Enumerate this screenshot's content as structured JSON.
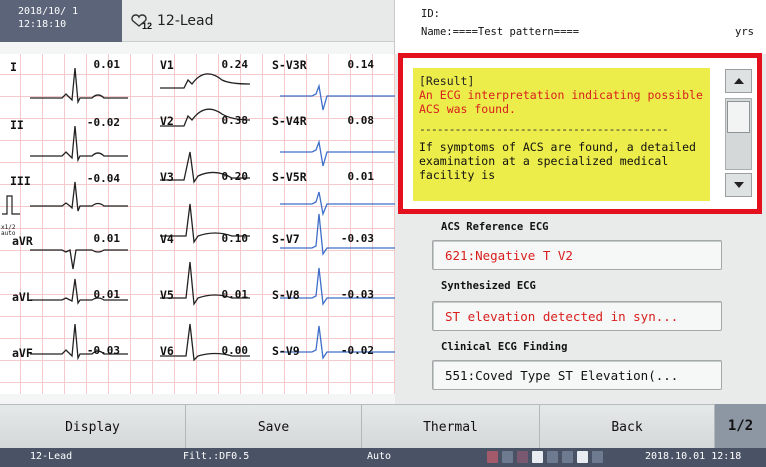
{
  "header": {
    "date": "2018/10/ 1",
    "time": "12:18:10",
    "title": "12-Lead",
    "heart_icon_subscript": "12"
  },
  "patient": {
    "id_label": "ID:",
    "name": "Name:====Test pattern====",
    "age_unit": "yrs"
  },
  "ecg": {
    "leads": [
      {
        "label": "I",
        "value": "0.01"
      },
      {
        "label": "II",
        "value": "-0.02"
      },
      {
        "label": "III",
        "value": "-0.04"
      },
      {
        "label": "aVR",
        "value": "0.01"
      },
      {
        "label": "aVL",
        "value": "0.01"
      },
      {
        "label": "aVF",
        "value": "-0.03"
      },
      {
        "label": "V1",
        "value": "0.24"
      },
      {
        "label": "V2",
        "value": "0.38"
      },
      {
        "label": "V3",
        "value": "0.20"
      },
      {
        "label": "V4",
        "value": "0.10"
      },
      {
        "label": "V5",
        "value": "0.01"
      },
      {
        "label": "V6",
        "value": "0.00"
      },
      {
        "label": "S-V3R",
        "value": "0.14"
      },
      {
        "label": "S-V4R",
        "value": "0.08"
      },
      {
        "label": "S-V5R",
        "value": "0.01"
      },
      {
        "label": "S-V7",
        "value": "-0.03"
      },
      {
        "label": "S-V8",
        "value": "-0.03"
      },
      {
        "label": "S-V9",
        "value": "-0.02"
      }
    ],
    "cal_label_1": "x1/2",
    "cal_label_2": "auto"
  },
  "result": {
    "header": "[Result]",
    "alert": "An ECG interpretation indicating possible ACS was found.",
    "separator": "------------------------------------------",
    "body": "If symptoms of ACS are found, a detailed examination at a specialized medical facility is"
  },
  "acs_reference": {
    "label": "ACS Reference ECG",
    "value": "621:Negative T V2"
  },
  "synthesized": {
    "label": "Synthesized ECG",
    "value": "ST elevation detected in syn..."
  },
  "clinical": {
    "label": "Clinical ECG Finding",
    "value": "551:Coved Type ST Elevation(..."
  },
  "nav": {
    "display": "Display",
    "save": "Save",
    "thermal": "Thermal",
    "back": "Back",
    "page": "1/2"
  },
  "status": {
    "mode": "12-Lead",
    "filter": "Filt.:DF0.5",
    "auto": "Auto",
    "datetime": "2018.10.01 12:18"
  },
  "colors": {
    "result_bg": "#ecec4a",
    "highlight_frame": "#e4101e",
    "alert_text": "#d8201e",
    "finding_text": "#d8201e",
    "ecg_grid": "#f3c9c9",
    "synth_trace": "#3f6fc8"
  }
}
